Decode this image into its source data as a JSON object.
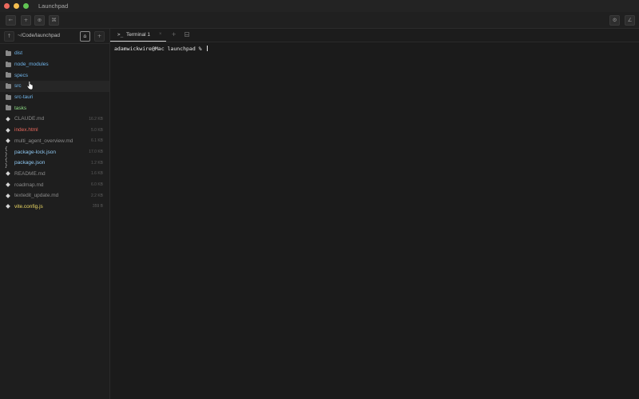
{
  "window": {
    "title": "Launchpad",
    "traffic_lights": [
      {
        "name": "close",
        "color": "#ed6a5e"
      },
      {
        "name": "minimize",
        "color": "#f5bf4f"
      },
      {
        "name": "zoom",
        "color": "#61c554"
      }
    ]
  },
  "toolbar": {
    "back_icon": "←",
    "add_icon": "+",
    "globe_icon": "⊕",
    "command_icon": "⌘",
    "gear_icon": "⚙",
    "edit_icon": "∠"
  },
  "sidebar": {
    "path": "~/Code/launchpad",
    "up_icon": "↑",
    "home_icon": "⌂",
    "add_icon": "+",
    "items": [
      {
        "name": "dist",
        "type": "folder",
        "size": "",
        "color": "#6fb3e8"
      },
      {
        "name": "node_modules",
        "type": "folder",
        "size": "",
        "color": "#6fb3e8"
      },
      {
        "name": "specs",
        "type": "folder",
        "size": "",
        "color": "#6fb3e8"
      },
      {
        "name": "src",
        "type": "folder",
        "size": "",
        "color": "#6fb3e8"
      },
      {
        "name": "src-tauri",
        "type": "folder",
        "size": "",
        "color": "#6fb3e8"
      },
      {
        "name": "tasks",
        "type": "folder",
        "size": "",
        "color": "#8ddc84"
      },
      {
        "name": "CLAUDE.md",
        "type": "md",
        "size": "16.2 KB",
        "color": "#8a8a8a"
      },
      {
        "name": "index.html",
        "type": "html",
        "size": "5.0 KB",
        "color": "#e8675c"
      },
      {
        "name": "multi_agent_overview.md",
        "type": "md",
        "size": "6.1 KB",
        "color": "#8a8a8a"
      },
      {
        "name": "package-lock.json",
        "type": "json",
        "size": "17.0 KB",
        "color": "#8fc7f0"
      },
      {
        "name": "package.json",
        "type": "json",
        "size": "1.2 KB",
        "color": "#8fc7f0"
      },
      {
        "name": "README.md",
        "type": "md",
        "size": "1.6 KB",
        "color": "#8a8a8a"
      },
      {
        "name": "roadmap.md",
        "type": "md",
        "size": "6.0 KB",
        "color": "#8a8a8a"
      },
      {
        "name": "textedit_update.md",
        "type": "md",
        "size": "2.2 KB",
        "color": "#8a8a8a"
      },
      {
        "name": "vite.config.js",
        "type": "js",
        "size": "359 B",
        "color": "#ecd864"
      }
    ]
  },
  "tabs": [
    {
      "icon": ">_",
      "label": "Terminal 1",
      "close": "×"
    }
  ],
  "tab_add_icon": "+",
  "terminal": {
    "prompt": "adamwickwire@Mac launchpad % "
  }
}
